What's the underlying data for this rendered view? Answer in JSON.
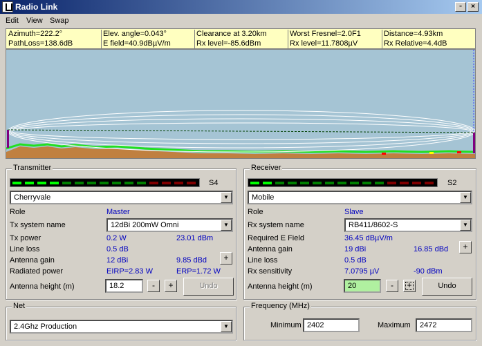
{
  "window": {
    "title": "Radio Link"
  },
  "menu": [
    "Edit",
    "View",
    "Swap"
  ],
  "info": {
    "row1": [
      "Azimuth=222.2°",
      "Elev. angle=0.043°",
      "Clearance at 3.20km",
      "Worst Fresnel=2.0F1",
      "Distance=4.93km"
    ],
    "row2": [
      "PathLoss=138.6dB",
      "E field=40.9dBµV/m",
      "Rx level=-85.6dBm",
      "Rx level=11.7808µV",
      "Rx Relative=4.4dB"
    ]
  },
  "transmitter": {
    "legend": "Transmitter",
    "signal_label": "S4",
    "site": "Cherryvale",
    "role_label": "Role",
    "role": "Master",
    "system_label": "Tx system name",
    "system": "12dBi 200mW Omni",
    "power_label": "Tx power",
    "power_w": "0.2 W",
    "power_dbm": "23.01 dBm",
    "line_loss_label": "Line loss",
    "line_loss": "0.5 dB",
    "gain_label": "Antenna gain",
    "gain_dbi": "12 dBi",
    "gain_dbd": "9.85 dBd",
    "radiated_label": "Radiated power",
    "eirp": "EIRP=2.83 W",
    "erp": "ERP=1.72 W",
    "height_label": "Antenna height (m)",
    "height": "18.2",
    "undo": "Undo"
  },
  "receiver": {
    "legend": "Receiver",
    "signal_label": "S2",
    "site": "Mobile",
    "role_label": "Role",
    "role": "Slave",
    "system_label": "Rx system name",
    "system": "RB411/8602-S",
    "req_label": "Required E Field",
    "req": "36.45 dBµV/m",
    "gain_label": "Antenna gain",
    "gain_dbi": "19 dBi",
    "gain_dbd": "16.85 dBd",
    "line_loss_label": "Line loss",
    "line_loss": "0.5 dB",
    "sens_label": "Rx sensitivity",
    "sens_uv": "7.0795 µV",
    "sens_dbm": "-90 dBm",
    "height_label": "Antenna height (m)",
    "height": "20",
    "undo": "Undo"
  },
  "net": {
    "legend": "Net",
    "value": "2.4Ghz Production"
  },
  "frequency": {
    "legend": "Frequency (MHz)",
    "min_label": "Minimum",
    "min": "2402",
    "max_label": "Maximum",
    "max": "2472"
  },
  "colors": {
    "signal_on": "#00ff00",
    "signal_mid": "#008000",
    "signal_high": "#800000",
    "value_text": "#0000c0"
  }
}
